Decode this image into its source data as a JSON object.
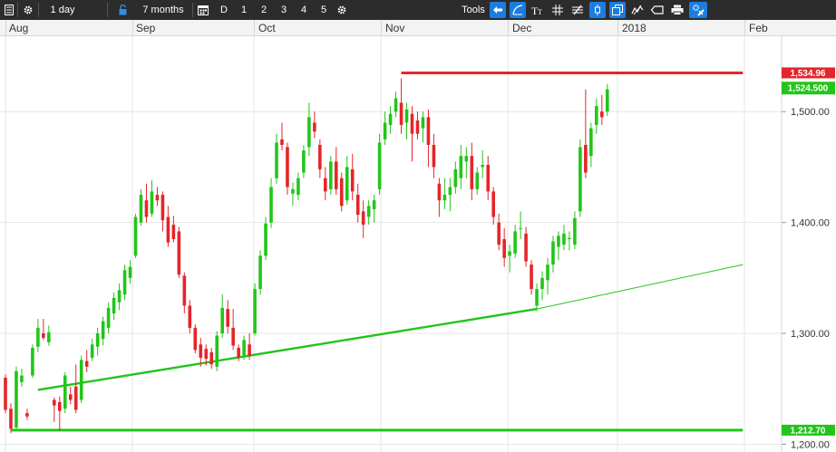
{
  "toolbar": {
    "interval": "1 day",
    "range": "7 months",
    "periods": [
      "D",
      "1",
      "2",
      "3",
      "4",
      "5"
    ],
    "tools_label": "Tools"
  },
  "chart_data": {
    "type": "candlestick",
    "x_labels": [
      "Aug",
      "Sep",
      "Oct",
      "Nov",
      "Dec",
      "2018",
      "Feb"
    ],
    "y_ticks": [
      "1,200.00",
      "1,300.00",
      "1,400.00",
      "1,500.00"
    ],
    "y_tick_values": [
      1200,
      1300,
      1400,
      1500
    ],
    "ylim": [
      1193,
      1568
    ],
    "bull_color": "#22c51a",
    "bear_color": "#e5252a",
    "candles": [
      {
        "d": "Jul 31",
        "o": 1260,
        "h": 1263,
        "l": 1228,
        "c": 1231
      },
      {
        "d": "Aug 1",
        "o": 1232,
        "h": 1237,
        "l": 1210,
        "c": 1214
      },
      {
        "d": "Aug 2",
        "o": 1215,
        "h": 1270,
        "l": 1212,
        "c": 1266
      },
      {
        "d": "Aug 3",
        "o": 1256,
        "h": 1268,
        "l": 1252,
        "c": 1262
      },
      {
        "d": "Aug 4",
        "o": 1228,
        "h": 1232,
        "l": 1222,
        "c": 1225
      },
      {
        "d": "Aug 7",
        "o": 1262,
        "h": 1290,
        "l": 1260,
        "c": 1287
      },
      {
        "d": "Aug 8",
        "o": 1288,
        "h": 1313,
        "l": 1283,
        "c": 1305
      },
      {
        "d": "Aug 9",
        "o": 1300,
        "h": 1313,
        "l": 1294,
        "c": 1296
      },
      {
        "d": "Aug 10",
        "o": 1292,
        "h": 1307,
        "l": 1289,
        "c": 1301
      },
      {
        "d": "Aug 11",
        "o": 1240,
        "h": 1242,
        "l": 1220,
        "c": 1235
      },
      {
        "d": "Aug 14",
        "o": 1238,
        "h": 1243,
        "l": 1212,
        "c": 1230
      },
      {
        "d": "Aug 15",
        "o": 1232,
        "h": 1265,
        "l": 1228,
        "c": 1262
      },
      {
        "d": "Aug 16",
        "o": 1245,
        "h": 1252,
        "l": 1236,
        "c": 1240
      },
      {
        "d": "Aug 17",
        "o": 1252,
        "h": 1272,
        "l": 1228,
        "c": 1231
      },
      {
        "d": "Aug 18",
        "o": 1240,
        "h": 1280,
        "l": 1237,
        "c": 1276
      },
      {
        "d": "Aug 21",
        "o": 1275,
        "h": 1285,
        "l": 1265,
        "c": 1270
      },
      {
        "d": "Aug 22",
        "o": 1278,
        "h": 1295,
        "l": 1275,
        "c": 1290
      },
      {
        "d": "Aug 23",
        "o": 1288,
        "h": 1305,
        "l": 1280,
        "c": 1300
      },
      {
        "d": "Aug 24",
        "o": 1295,
        "h": 1315,
        "l": 1289,
        "c": 1311
      },
      {
        "d": "Aug 25",
        "o": 1305,
        "h": 1328,
        "l": 1300,
        "c": 1323
      },
      {
        "d": "Aug 28",
        "o": 1318,
        "h": 1337,
        "l": 1312,
        "c": 1332
      },
      {
        "d": "Aug 29",
        "o": 1328,
        "h": 1345,
        "l": 1321,
        "c": 1339
      },
      {
        "d": "Aug 30",
        "o": 1335,
        "h": 1362,
        "l": 1330,
        "c": 1357
      },
      {
        "d": "Aug 31",
        "o": 1350,
        "h": 1366,
        "l": 1345,
        "c": 1360
      },
      {
        "d": "Sep 1",
        "o": 1370,
        "h": 1408,
        "l": 1368,
        "c": 1405
      },
      {
        "d": "Sep 4",
        "o": 1400,
        "h": 1430,
        "l": 1397,
        "c": 1425
      },
      {
        "d": "Sep 5",
        "o": 1420,
        "h": 1435,
        "l": 1400,
        "c": 1405
      },
      {
        "d": "Sep 6",
        "o": 1408,
        "h": 1438,
        "l": 1405,
        "c": 1428
      },
      {
        "d": "Sep 7",
        "o": 1425,
        "h": 1432,
        "l": 1415,
        "c": 1420
      },
      {
        "d": "Sep 8",
        "o": 1425,
        "h": 1428,
        "l": 1392,
        "c": 1402
      },
      {
        "d": "Sep 11",
        "o": 1405,
        "h": 1415,
        "l": 1378,
        "c": 1382
      },
      {
        "d": "Sep 12",
        "o": 1398,
        "h": 1406,
        "l": 1382,
        "c": 1385
      },
      {
        "d": "Sep 13",
        "o": 1392,
        "h": 1396,
        "l": 1350,
        "c": 1353
      },
      {
        "d": "Sep 14",
        "o": 1352,
        "h": 1355,
        "l": 1318,
        "c": 1325
      },
      {
        "d": "Sep 15",
        "o": 1325,
        "h": 1330,
        "l": 1300,
        "c": 1305
      },
      {
        "d": "Sep 18",
        "o": 1305,
        "h": 1308,
        "l": 1282,
        "c": 1285
      },
      {
        "d": "Sep 19",
        "o": 1290,
        "h": 1296,
        "l": 1270,
        "c": 1278
      },
      {
        "d": "Sep 20",
        "o": 1286,
        "h": 1290,
        "l": 1271,
        "c": 1277
      },
      {
        "d": "Sep 21",
        "o": 1283,
        "h": 1287,
        "l": 1268,
        "c": 1272
      },
      {
        "d": "Sep 22",
        "o": 1270,
        "h": 1302,
        "l": 1266,
        "c": 1298
      },
      {
        "d": "Sep 25",
        "o": 1300,
        "h": 1335,
        "l": 1296,
        "c": 1323
      },
      {
        "d": "Sep 26",
        "o": 1322,
        "h": 1330,
        "l": 1300,
        "c": 1306
      },
      {
        "d": "Sep 27",
        "o": 1305,
        "h": 1322,
        "l": 1285,
        "c": 1289
      },
      {
        "d": "Sep 28",
        "o": 1287,
        "h": 1290,
        "l": 1275,
        "c": 1278
      },
      {
        "d": "Sep 29",
        "o": 1280,
        "h": 1298,
        "l": 1276,
        "c": 1294
      },
      {
        "d": "Oct 2",
        "o": 1290,
        "h": 1300,
        "l": 1276,
        "c": 1280
      },
      {
        "d": "Oct 3",
        "o": 1300,
        "h": 1345,
        "l": 1298,
        "c": 1340
      },
      {
        "d": "Oct 4",
        "o": 1340,
        "h": 1375,
        "l": 1335,
        "c": 1370
      },
      {
        "d": "Oct 5",
        "o": 1370,
        "h": 1405,
        "l": 1366,
        "c": 1399
      },
      {
        "d": "Oct 6",
        "o": 1400,
        "h": 1440,
        "l": 1395,
        "c": 1432
      },
      {
        "d": "Oct 9",
        "o": 1440,
        "h": 1480,
        "l": 1435,
        "c": 1472
      },
      {
        "d": "Oct 10",
        "o": 1475,
        "h": 1490,
        "l": 1465,
        "c": 1470
      },
      {
        "d": "Oct 11",
        "o": 1468,
        "h": 1472,
        "l": 1425,
        "c": 1432
      },
      {
        "d": "Oct 12",
        "o": 1426,
        "h": 1436,
        "l": 1415,
        "c": 1430
      },
      {
        "d": "Oct 13",
        "o": 1425,
        "h": 1445,
        "l": 1420,
        "c": 1440
      },
      {
        "d": "Oct 16",
        "o": 1445,
        "h": 1470,
        "l": 1440,
        "c": 1465
      },
      {
        "d": "Oct 17",
        "o": 1468,
        "h": 1508,
        "l": 1460,
        "c": 1495
      },
      {
        "d": "Oct 18",
        "o": 1490,
        "h": 1500,
        "l": 1476,
        "c": 1482
      },
      {
        "d": "Oct 19",
        "o": 1470,
        "h": 1475,
        "l": 1440,
        "c": 1448
      },
      {
        "d": "Oct 20",
        "o": 1440,
        "h": 1450,
        "l": 1420,
        "c": 1428
      },
      {
        "d": "Oct 23",
        "o": 1430,
        "h": 1460,
        "l": 1425,
        "c": 1455
      },
      {
        "d": "Oct 24",
        "o": 1455,
        "h": 1468,
        "l": 1425,
        "c": 1430
      },
      {
        "d": "Oct 25",
        "o": 1440,
        "h": 1445,
        "l": 1410,
        "c": 1415
      },
      {
        "d": "Oct 26",
        "o": 1420,
        "h": 1460,
        "l": 1416,
        "c": 1450
      },
      {
        "d": "Oct 27",
        "o": 1448,
        "h": 1462,
        "l": 1420,
        "c": 1428
      },
      {
        "d": "Oct 30",
        "o": 1425,
        "h": 1435,
        "l": 1400,
        "c": 1407
      },
      {
        "d": "Oct 31",
        "o": 1410,
        "h": 1420,
        "l": 1386,
        "c": 1398
      },
      {
        "d": "Nov 1",
        "o": 1405,
        "h": 1420,
        "l": 1398,
        "c": 1415
      },
      {
        "d": "Nov 2",
        "o": 1412,
        "h": 1425,
        "l": 1400,
        "c": 1420
      },
      {
        "d": "Nov 3",
        "o": 1430,
        "h": 1480,
        "l": 1425,
        "c": 1472
      },
      {
        "d": "Nov 6",
        "o": 1475,
        "h": 1500,
        "l": 1470,
        "c": 1490
      },
      {
        "d": "Nov 7",
        "o": 1488,
        "h": 1505,
        "l": 1480,
        "c": 1498
      },
      {
        "d": "Nov 8",
        "o": 1500,
        "h": 1518,
        "l": 1495,
        "c": 1512
      },
      {
        "d": "Nov 9",
        "o": 1508,
        "h": 1530,
        "l": 1480,
        "c": 1488
      },
      {
        "d": "Nov 10",
        "o": 1490,
        "h": 1508,
        "l": 1475,
        "c": 1502
      },
      {
        "d": "Nov 13",
        "o": 1498,
        "h": 1505,
        "l": 1455,
        "c": 1480
      },
      {
        "d": "Nov 14",
        "o": 1492,
        "h": 1500,
        "l": 1475,
        "c": 1480
      },
      {
        "d": "Nov 15",
        "o": 1485,
        "h": 1500,
        "l": 1472,
        "c": 1495
      },
      {
        "d": "Nov 16",
        "o": 1495,
        "h": 1502,
        "l": 1450,
        "c": 1470
      },
      {
        "d": "Nov 17",
        "o": 1470,
        "h": 1480,
        "l": 1440,
        "c": 1450
      },
      {
        "d": "Nov 20",
        "o": 1435,
        "h": 1440,
        "l": 1405,
        "c": 1420
      },
      {
        "d": "Nov 21",
        "o": 1420,
        "h": 1440,
        "l": 1412,
        "c": 1425
      },
      {
        "d": "Nov 22",
        "o": 1425,
        "h": 1440,
        "l": 1410,
        "c": 1432
      },
      {
        "d": "Nov 24",
        "o": 1432,
        "h": 1455,
        "l": 1426,
        "c": 1448
      },
      {
        "d": "Nov 27",
        "o": 1440,
        "h": 1470,
        "l": 1430,
        "c": 1460
      },
      {
        "d": "Nov 28",
        "o": 1455,
        "h": 1468,
        "l": 1440,
        "c": 1460
      },
      {
        "d": "Nov 29",
        "o": 1460,
        "h": 1472,
        "l": 1420,
        "c": 1430
      },
      {
        "d": "Nov 30",
        "o": 1430,
        "h": 1450,
        "l": 1425,
        "c": 1445
      },
      {
        "d": "Dec 1",
        "o": 1450,
        "h": 1465,
        "l": 1440,
        "c": 1452
      },
      {
        "d": "Dec 4",
        "o": 1452,
        "h": 1460,
        "l": 1420,
        "c": 1428
      },
      {
        "d": "Dec 5",
        "o": 1428,
        "h": 1432,
        "l": 1398,
        "c": 1405
      },
      {
        "d": "Dec 6",
        "o": 1400,
        "h": 1408,
        "l": 1375,
        "c": 1380
      },
      {
        "d": "Dec 7",
        "o": 1385,
        "h": 1395,
        "l": 1360,
        "c": 1368
      },
      {
        "d": "Dec 8",
        "o": 1370,
        "h": 1380,
        "l": 1355,
        "c": 1374
      },
      {
        "d": "Dec 11",
        "o": 1372,
        "h": 1398,
        "l": 1368,
        "c": 1392
      },
      {
        "d": "Dec 12",
        "o": 1395,
        "h": 1410,
        "l": 1385,
        "c": 1395
      },
      {
        "d": "Dec 13",
        "o": 1390,
        "h": 1396,
        "l": 1360,
        "c": 1365
      },
      {
        "d": "Dec 14",
        "o": 1362,
        "h": 1366,
        "l": 1335,
        "c": 1340
      },
      {
        "d": "Dec 15",
        "o": 1325,
        "h": 1345,
        "l": 1320,
        "c": 1340
      },
      {
        "d": "Dec 18",
        "o": 1340,
        "h": 1356,
        "l": 1330,
        "c": 1350
      },
      {
        "d": "Dec 19",
        "o": 1348,
        "h": 1368,
        "l": 1335,
        "c": 1362
      },
      {
        "d": "Dec 20",
        "o": 1362,
        "h": 1388,
        "l": 1355,
        "c": 1383
      },
      {
        "d": "Dec 21",
        "o": 1378,
        "h": 1392,
        "l": 1366,
        "c": 1388
      },
      {
        "d": "Dec 22",
        "o": 1380,
        "h": 1398,
        "l": 1375,
        "c": 1390
      },
      {
        "d": "Dec 26",
        "o": 1385,
        "h": 1392,
        "l": 1375,
        "c": 1386
      },
      {
        "d": "Dec 27",
        "o": 1380,
        "h": 1410,
        "l": 1376,
        "c": 1404
      },
      {
        "d": "Dec 28",
        "o": 1410,
        "h": 1475,
        "l": 1405,
        "c": 1468
      },
      {
        "d": "Dec 29",
        "o": 1470,
        "h": 1520,
        "l": 1440,
        "c": 1445
      },
      {
        "d": "Jan 2",
        "o": 1460,
        "h": 1490,
        "l": 1450,
        "c": 1485
      },
      {
        "d": "Jan 3",
        "o": 1488,
        "h": 1512,
        "l": 1480,
        "c": 1505
      },
      {
        "d": "Jan 4",
        "o": 1500,
        "h": 1515,
        "l": 1488,
        "c": 1495
      },
      {
        "d": "Jan 5",
        "o": 1500,
        "h": 1525,
        "l": 1496,
        "c": 1520
      }
    ],
    "support_line_lower": {
      "from": {
        "d": "Aug 8",
        "v": 1249
      },
      "to": {
        "d": "Dec 15",
        "v": 1322
      }
    },
    "support_line_extended": {
      "from": {
        "d": "Dec 15",
        "v": 1322
      },
      "to": {
        "d": "Feb 9",
        "v": 1362
      }
    },
    "resistance_line": {
      "from": {
        "d": "Nov 9",
        "v": 1534.96
      },
      "to": {
        "d": "Feb 9",
        "v": 1534.96
      }
    },
    "bottom_line": {
      "from": {
        "d": "Aug 1",
        "v": 1212.7
      },
      "to": {
        "d": "Feb 9",
        "v": 1212.7
      }
    },
    "price_tags": [
      {
        "label": "1,534.96",
        "value": 1534.96,
        "color": "#e5252a"
      },
      {
        "label": "1,524.500",
        "value": 1524.5,
        "color": "#22c51a"
      },
      {
        "label": "1,212.70",
        "value": 1212.7,
        "color": "#22c51a"
      }
    ]
  }
}
